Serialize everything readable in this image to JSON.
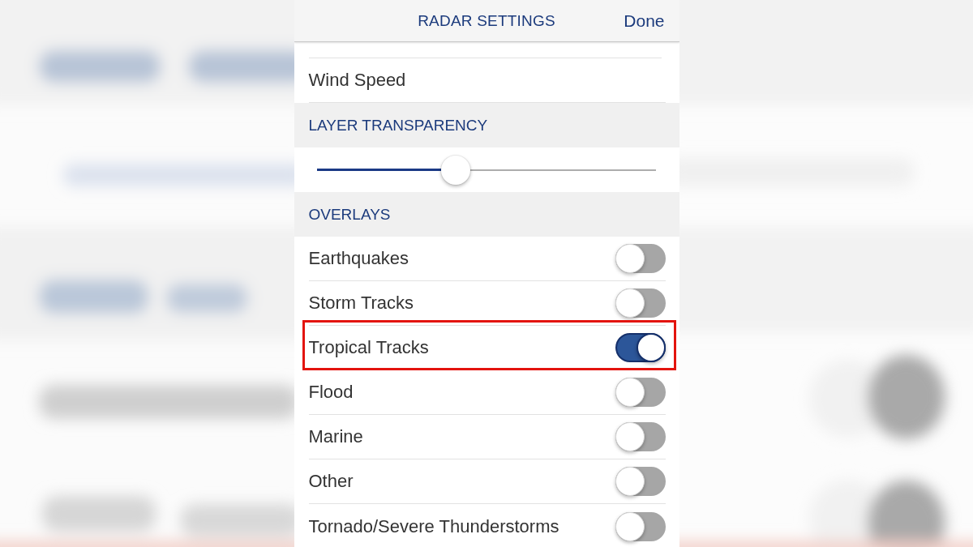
{
  "header": {
    "title": "RADAR SETTINGS",
    "done": "Done"
  },
  "layers": [
    {
      "label": "Wind Speed"
    }
  ],
  "layer_transparency": {
    "heading": "LAYER TRANSPARENCY",
    "level": 0.41
  },
  "overlays": {
    "heading": "OVERLAYS",
    "items": [
      {
        "label": "Earthquakes",
        "on": false,
        "highlighted": false
      },
      {
        "label": "Storm Tracks",
        "on": false,
        "highlighted": false
      },
      {
        "label": "Tropical Tracks",
        "on": true,
        "highlighted": true
      },
      {
        "label": "Flood",
        "on": false,
        "highlighted": false
      },
      {
        "label": "Marine",
        "on": false,
        "highlighted": false
      },
      {
        "label": "Other",
        "on": false,
        "highlighted": false
      },
      {
        "label": "Tornado/Severe Thunderstorms",
        "on": false,
        "highlighted": false
      }
    ]
  }
}
